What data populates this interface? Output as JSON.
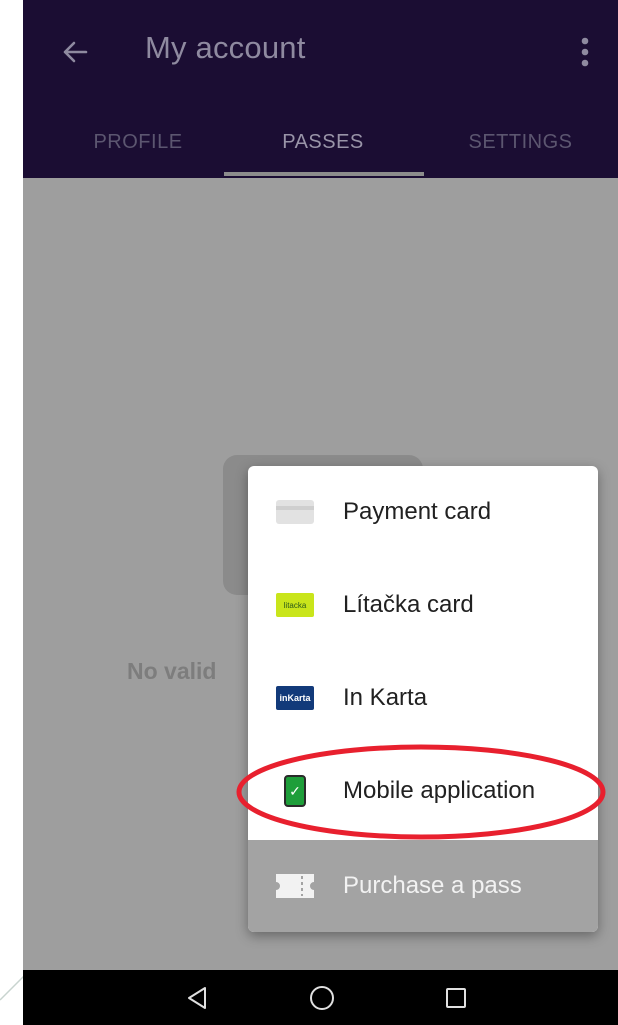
{
  "app_bar": {
    "title": "My account",
    "back_icon": "arrow-left-icon",
    "more_icon": "more-vert-icon"
  },
  "tabs": [
    {
      "label": "PROFILE",
      "selected": false
    },
    {
      "label": "PASSES",
      "selected": true
    },
    {
      "label": "SETTINGS",
      "selected": false
    }
  ],
  "content": {
    "empty_text": "No valid"
  },
  "menu": {
    "items": [
      {
        "label": "Payment card",
        "icon": "payment-card-icon"
      },
      {
        "label": "Lítačka card",
        "icon": "litacka-card-icon",
        "icon_text": "litacka"
      },
      {
        "label": "In Karta",
        "icon": "in-karta-icon",
        "icon_text": "inKarta"
      },
      {
        "label": "Mobile application",
        "icon": "mobile-phone-icon"
      },
      {
        "label": "Purchase a pass",
        "icon": "ticket-icon"
      }
    ]
  },
  "colors": {
    "app_bar": "#1b0d33",
    "highlight": "#e8202e",
    "litacka": "#c9e51b",
    "in_karta": "#123a7a",
    "mobile": "#1e9e3a"
  },
  "nav_bar": {
    "back_icon": "triangle-back-icon",
    "home_icon": "circle-home-icon",
    "recent_icon": "square-recents-icon"
  }
}
